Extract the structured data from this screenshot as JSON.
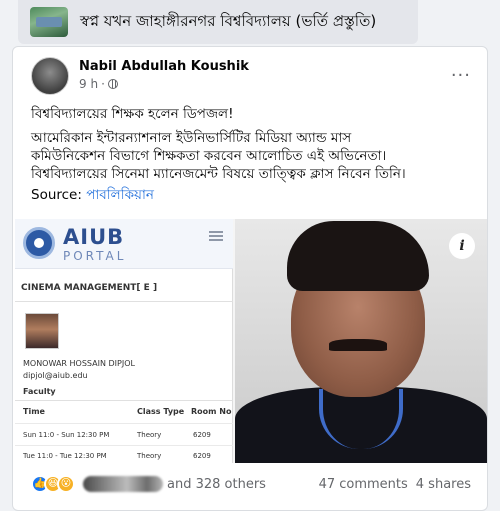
{
  "group": {
    "title": "স্বপ্ন যখন জাহাঙ্গীরনগর বিশ্ববিদ্যালয় (ভর্তি প্রস্তুতি)"
  },
  "post": {
    "author": "Nabil Abdullah Koushik",
    "time": "9 h",
    "separator": "·",
    "more_label": "···",
    "headline": "বিশ্ববিদ্যালয়ের শিক্ষক হলেন ডিপজল!",
    "body_line1": "আমেরিকান ইন্টারন্যাশনাল ইউনিভার্সিটির মিডিয়া অ্যান্ড মাস",
    "body_line2": "কমিউনিকেশন বিভাগে শিক্ষকতা করবেন আলোচিত এই  অভিনেতা।",
    "body_line3": "বিশ্ববিদ্যালয়ের  সিনেমা ম্যানেজমেন্ট বিষয়ে তাত্ত্বিক ক্লাস নিবেন তিনি।",
    "source_label": "Source:",
    "source_link": "পাবলিকিয়ান"
  },
  "portal": {
    "brand": "AIUB",
    "brand_sub": "PORTAL",
    "course": "CINEMA MANAGEMENT[ E ]",
    "faculty_name": "MONOWAR HOSSAIN DIPJOL",
    "faculty_email": "dipjol@aiub.edu",
    "faculty_label": "Faculty",
    "columns": [
      "Time",
      "Class Type",
      "Room No"
    ],
    "rows": [
      {
        "time": "Sun 11:0 - Sun 12:30 PM",
        "type": "Theory",
        "room": "6209"
      },
      {
        "time": "Tue 11:0 - Tue 12:30 PM",
        "type": "Theory",
        "room": "6209"
      }
    ]
  },
  "photo": {
    "info_label": "i"
  },
  "footer": {
    "others": "and 328 others",
    "comments": "47 comments",
    "shares": "4 shares"
  }
}
